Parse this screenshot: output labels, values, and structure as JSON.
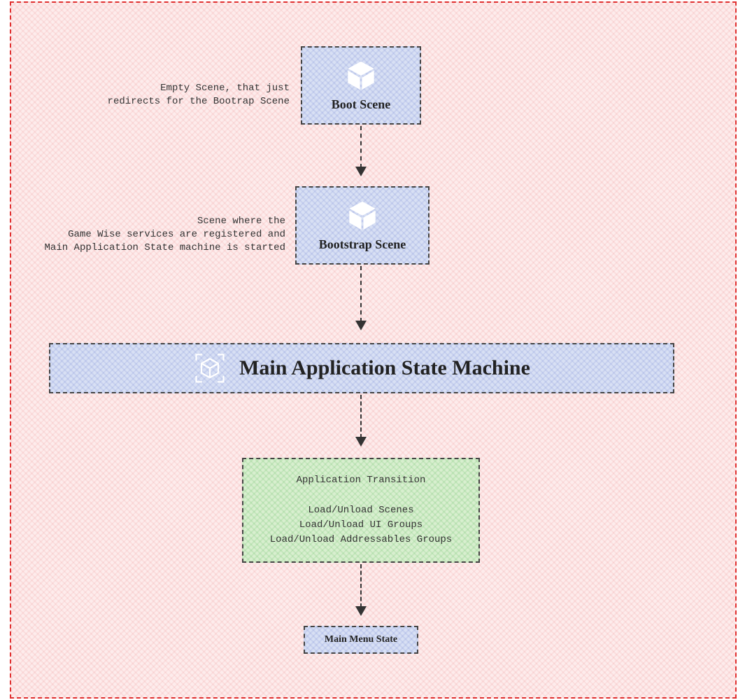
{
  "frame": {
    "color": "#e03030"
  },
  "boot": {
    "title": "Boot Scene",
    "caption": "Empty Scene, that just\nredirects for the Bootrap Scene"
  },
  "bootstrap": {
    "title": "Bootstrap Scene",
    "caption": "Scene where the\nGame Wise services are registered and\nMain Application State machine is started"
  },
  "stateMachine": {
    "title": "Main Application State Machine"
  },
  "transition": {
    "title": "Application Transition",
    "line1": "Load/Unload Scenes",
    "line2": "Load/Unload UI Groups",
    "line3": "Load/Unload Addressables Groups"
  },
  "mainMenu": {
    "title": "Main Menu State"
  },
  "icons": {
    "unityCube": "unity-cube-icon",
    "scanCube": "scan-cube-icon"
  }
}
